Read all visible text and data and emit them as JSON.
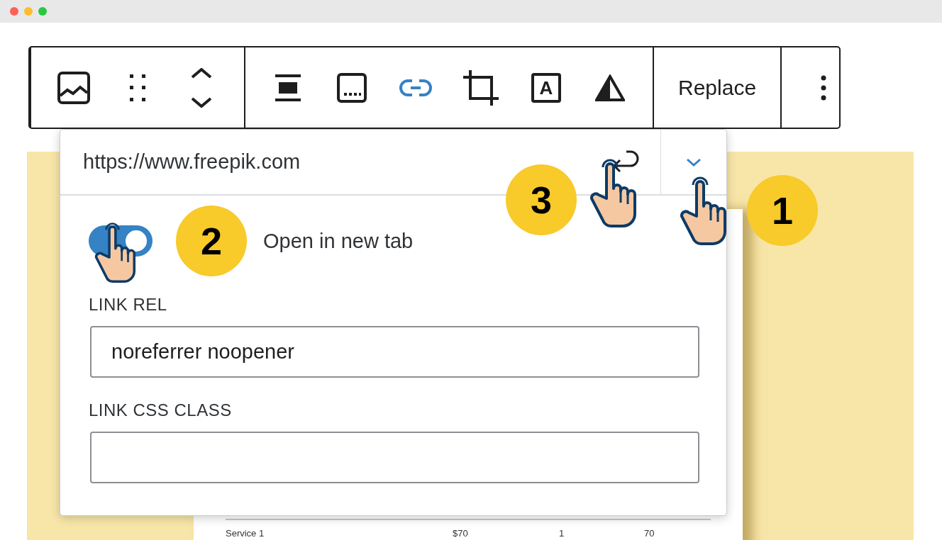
{
  "toolbar": {
    "groups": [
      {
        "tools": [
          {
            "kind": "image",
            "active": false
          },
          {
            "kind": "drag",
            "active": false
          },
          {
            "kind": "mover",
            "active": false
          }
        ]
      },
      {
        "tools": [
          {
            "kind": "align",
            "active": false
          },
          {
            "kind": "caption",
            "active": false
          },
          {
            "kind": "link",
            "active": true
          },
          {
            "kind": "crop",
            "active": false
          },
          {
            "kind": "text-overlay",
            "glyph": "A",
            "active": false
          },
          {
            "kind": "duotone",
            "active": false
          }
        ]
      },
      {
        "tools": [
          {
            "kind": "text",
            "label": "Replace",
            "active": false
          }
        ]
      },
      {
        "tools": [
          {
            "kind": "more",
            "active": false
          }
        ]
      }
    ]
  },
  "link_popover": {
    "url": "https://www.freepik.com",
    "open_in_new_tab": {
      "label": "Open in new tab",
      "on": true
    },
    "link_rel": {
      "label": "LINK REL",
      "value": "noreferrer noopener"
    },
    "link_css_class": {
      "label": "LINK CSS CLASS"
    }
  },
  "document": {
    "rows": [
      {
        "cells": [
          "Service 1",
          "$70",
          "1",
          "70"
        ]
      }
    ]
  },
  "annotations": [
    {
      "number": "1"
    },
    {
      "number": "2"
    },
    {
      "number": "3"
    }
  ]
}
